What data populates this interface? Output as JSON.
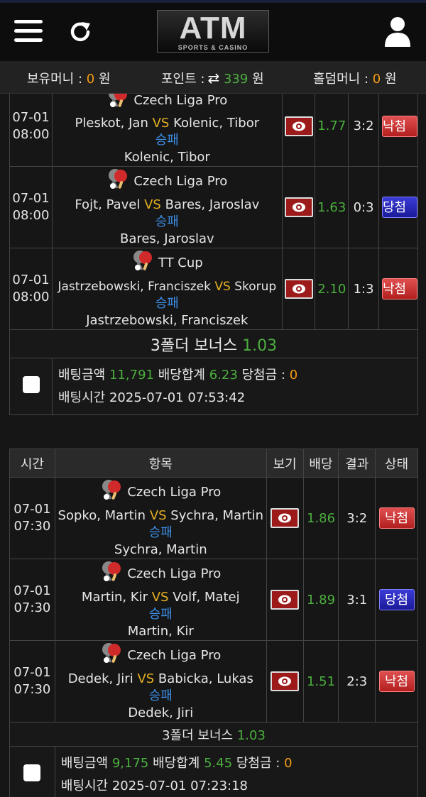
{
  "header": {
    "logo_main": "ATM",
    "logo_sub": "SPORTS & CASINO"
  },
  "balance": {
    "money_label": "보유머니 :",
    "money_value": "0",
    "money_unit": "원",
    "point_label": "포인트 :",
    "point_value": "339",
    "point_unit": "원",
    "holdem_label": "홀덤머니 :",
    "holdem_value": "0",
    "holdem_unit": "원"
  },
  "bet1": {
    "rows": [
      {
        "date": "07-01",
        "time": "08:00",
        "league": "Czech Liga Pro",
        "home": "Pleskot, Jan",
        "vs": "VS",
        "away": "Kolenic, Tibor",
        "market": "승패",
        "pick": "Kolenic, Tibor",
        "odd": "1.77",
        "score": "3:2",
        "status": "낙첨"
      },
      {
        "date": "07-01",
        "time": "08:00",
        "league": "Czech Liga Pro",
        "home": "Fojt, Pavel",
        "vs": "VS",
        "away": "Bares, Jaroslav",
        "market": "승패",
        "pick": "Bares, Jaroslav",
        "odd": "1.63",
        "score": "0:3",
        "status": "당첨"
      },
      {
        "date": "07-01",
        "time": "08:00",
        "league": "TT Cup",
        "home": "Jastrzebowski, Franciszek",
        "vs": "VS",
        "away": "Skorup",
        "market": "승패",
        "pick": "Jastrzebowski, Franciszek",
        "odd": "2.10",
        "score": "1:3",
        "status": "낙첨"
      }
    ],
    "bonus_label": "3폴더 보너스",
    "bonus_value": "1.03",
    "amount_label": "배팅금액",
    "amount_value": "11,791",
    "total_label": "배당합계",
    "total_value": "6.23",
    "win_label": "당첨금 :",
    "win_value": "0",
    "time_label": "배팅시간",
    "time_value": "2025-07-01 07:53:42"
  },
  "bet2": {
    "headers": {
      "time": "시간",
      "item": "항목",
      "view": "보기",
      "odd": "배당",
      "result": "결과",
      "status": "상태"
    },
    "rows": [
      {
        "date": "07-01",
        "time": "07:30",
        "league": "Czech Liga Pro",
        "home": "Sopko, Martin",
        "vs": "VS",
        "away": "Sychra, Martin",
        "market": "승패",
        "pick": "Sychra, Martin",
        "odd": "1.86",
        "score": "3:2",
        "status": "낙첨"
      },
      {
        "date": "07-01",
        "time": "07:30",
        "league": "Czech Liga Pro",
        "home": "Martin, Kir",
        "vs": "VS",
        "away": "Volf, Matej",
        "market": "승패",
        "pick": "Martin, Kir",
        "odd": "1.89",
        "score": "3:1",
        "status": "당첨"
      },
      {
        "date": "07-01",
        "time": "07:30",
        "league": "Czech Liga Pro",
        "home": "Dedek, Jiri",
        "vs": "VS",
        "away": "Babicka, Lukas",
        "market": "승패",
        "pick": "Dedek, Jiri",
        "odd": "1.51",
        "score": "2:3",
        "status": "낙첨"
      }
    ],
    "bonus_label": "3폴더 보너스",
    "bonus_value": "1.03",
    "amount_label": "배팅금액",
    "amount_value": "9,175",
    "total_label": "배당합계",
    "total_value": "5.45",
    "win_label": "당첨금 :",
    "win_value": "0",
    "time_label": "배팅시간",
    "time_value": "2025-07-01 07:23:18"
  }
}
